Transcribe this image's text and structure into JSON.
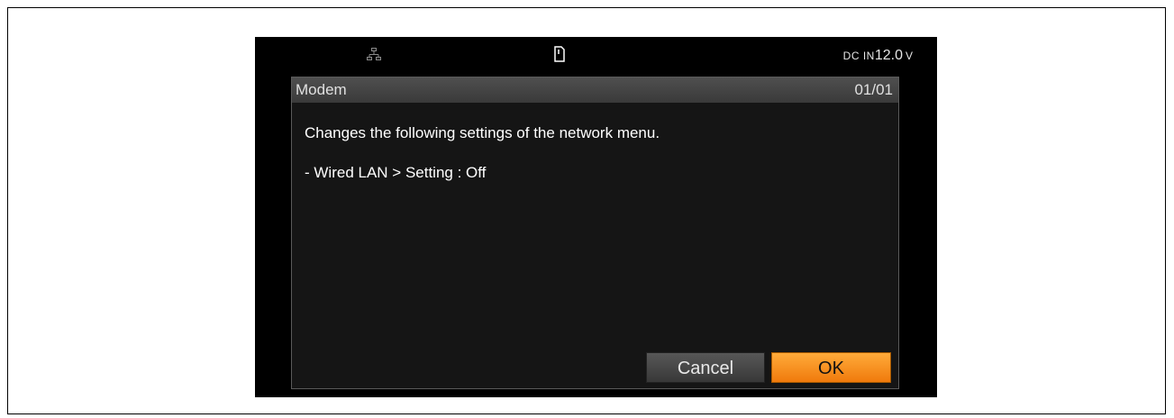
{
  "status_bar": {
    "icons": {
      "lan": "network-lan-icon",
      "media": "media-card-icon"
    },
    "power_source_label": "DC IN",
    "voltage_value": "12.0",
    "voltage_unit": "V"
  },
  "dialog": {
    "title": "Modem",
    "page_indicator": "01/01",
    "message_lines": [
      "Changes the following settings of the network menu.",
      "- Wired LAN > Setting : Off"
    ],
    "buttons": {
      "cancel_label": "Cancel",
      "ok_label": "OK"
    }
  },
  "colors": {
    "screen_background": "#000000",
    "dialog_background": "#151515",
    "title_bar": "#464646",
    "ok_button": "#f7901e",
    "cancel_button": "#474747"
  }
}
